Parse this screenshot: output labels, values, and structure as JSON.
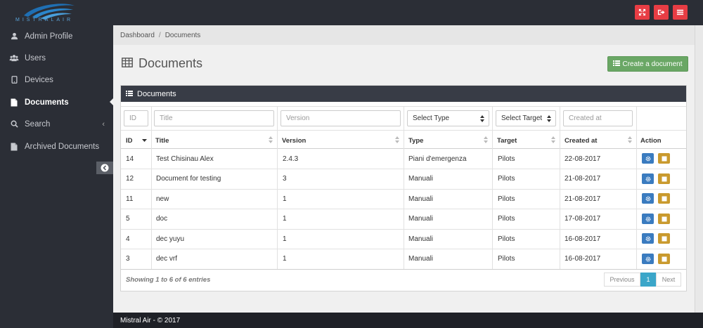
{
  "brand": {
    "logo_text": "MISTRALAIR",
    "footer": "Mistral Air - © 2017"
  },
  "colors": {
    "accent_red": "#e83d44",
    "success_green": "#6aa765",
    "panel_dark": "#383c46",
    "edit_blue": "#3a7bbf",
    "delete_gold": "#c99a2e",
    "pager_active": "#3ba6c9"
  },
  "topbar": {
    "buttons": [
      "fullscreen-icon",
      "logout-icon",
      "menu-icon"
    ]
  },
  "sidebar": {
    "items": [
      {
        "label": "Admin Profile",
        "icon": "user-icon"
      },
      {
        "label": "Users",
        "icon": "users-icon"
      },
      {
        "label": "Devices",
        "icon": "tablet-icon"
      },
      {
        "label": "Documents",
        "icon": "file-icon",
        "active": true
      },
      {
        "label": "Search",
        "icon": "search-icon",
        "has_children": true
      },
      {
        "label": "Archived Documents",
        "icon": "file-icon"
      }
    ],
    "chevron": "‹"
  },
  "breadcrumb": {
    "home": "Dashboard",
    "sep": "/",
    "current": "Documents"
  },
  "page": {
    "title": "Documents",
    "create_label": "Create a document"
  },
  "panel": {
    "title": "Documents"
  },
  "filters": {
    "id_placeholder": "ID",
    "title_placeholder": "Title",
    "version_placeholder": "Version",
    "type_value": "Select Type",
    "target_value": "Select Target",
    "created_placeholder": "Created at"
  },
  "table": {
    "columns": [
      "ID",
      "Title",
      "Version",
      "Type",
      "Target",
      "Created at",
      "Action"
    ],
    "rows": [
      {
        "id": "14",
        "title": "Test Chisinau Alex",
        "version": "2.4.3",
        "type": "Piani d'emergenza",
        "target": "Pilots",
        "created": "22-08-2017"
      },
      {
        "id": "12",
        "title": "Document for testing",
        "version": "3",
        "type": "Manuali",
        "target": "Pilots",
        "created": "21-08-2017"
      },
      {
        "id": "11",
        "title": "new",
        "version": "1",
        "type": "Manuali",
        "target": "Pilots",
        "created": "21-08-2017"
      },
      {
        "id": "5",
        "title": "doc",
        "version": "1",
        "type": "Manuali",
        "target": "Pilots",
        "created": "17-08-2017"
      },
      {
        "id": "4",
        "title": "dec yuyu",
        "version": "1",
        "type": "Manuali",
        "target": "Pilots",
        "created": "16-08-2017"
      },
      {
        "id": "3",
        "title": "dec vrf",
        "version": "1",
        "type": "Manuali",
        "target": "Pilots",
        "created": "16-08-2017"
      }
    ]
  },
  "pagination": {
    "info": "Showing 1 to 6 of 6 entries",
    "prev": "Previous",
    "current": "1",
    "next": "Next"
  }
}
